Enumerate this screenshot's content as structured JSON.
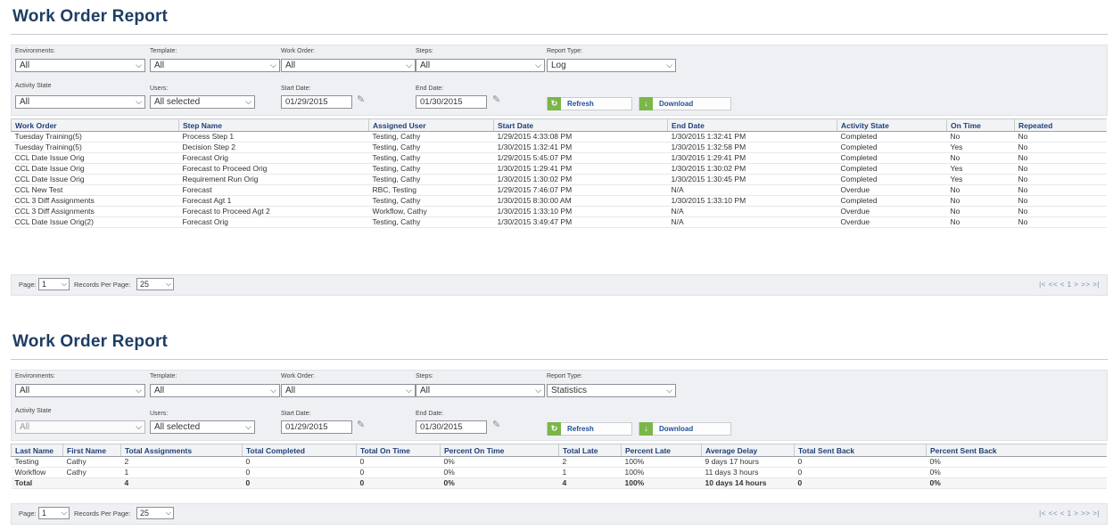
{
  "report1": {
    "title": "Work Order Report",
    "filters": {
      "environments": {
        "label": "Environments:",
        "value": "All"
      },
      "template": {
        "label": "Template:",
        "value": "All"
      },
      "work_order": {
        "label": "Work Order:",
        "value": "All"
      },
      "steps": {
        "label": "Steps:",
        "value": "All"
      },
      "report_type": {
        "label": "Report Type:",
        "value": "Log"
      },
      "activity_state": {
        "label": "Activity State",
        "value": "All"
      },
      "users": {
        "label": "Users:",
        "value": "All selected"
      },
      "start_date": {
        "label": "Start Date:",
        "value": "01/29/2015"
      },
      "end_date": {
        "label": "End Date:",
        "value": "01/30/2015"
      },
      "refresh_label": "Refresh",
      "download_label": "Download"
    },
    "table": {
      "headers": [
        "Work Order",
        "Step Name",
        "Assigned User",
        "Start Date",
        "End Date",
        "Activity State",
        "On Time",
        "Repeated"
      ],
      "rows": [
        [
          "Tuesday Training(5)",
          "Process Step 1",
          "Testing, Cathy",
          "1/29/2015 4:33:08 PM",
          "1/30/2015 1:32:41 PM",
          "Completed",
          "No",
          "No"
        ],
        [
          "Tuesday Training(5)",
          "Decision Step 2",
          "Testing, Cathy",
          "1/30/2015 1:32:41 PM",
          "1/30/2015 1:32:58 PM",
          "Completed",
          "Yes",
          "No"
        ],
        [
          "CCL Date Issue Orig",
          "Forecast Orig",
          "Testing, Cathy",
          "1/29/2015 5:45:07 PM",
          "1/30/2015 1:29:41 PM",
          "Completed",
          "No",
          "No"
        ],
        [
          "CCL Date Issue Orig",
          "Forecast to Proceed Orig",
          "Testing, Cathy",
          "1/30/2015 1:29:41 PM",
          "1/30/2015 1:30:02 PM",
          "Completed",
          "Yes",
          "No"
        ],
        [
          "CCL Date Issue Orig",
          "Requirement Run Orig",
          "Testing, Cathy",
          "1/30/2015 1:30:02 PM",
          "1/30/2015 1:30:45 PM",
          "Completed",
          "Yes",
          "No"
        ],
        [
          "CCL New Test",
          "Forecast",
          "RBC, Testing",
          "1/29/2015 7:46:07 PM",
          "N/A",
          "Overdue",
          "No",
          "No"
        ],
        [
          "CCL 3 Diff Assignments",
          "Forecast Agt 1",
          "Testing, Cathy",
          "1/30/2015 8:30:00 AM",
          "1/30/2015 1:33:10 PM",
          "Completed",
          "No",
          "No"
        ],
        [
          "CCL 3 Diff Assignments",
          "Forecast to Proceed Agt 2",
          "Workflow, Cathy",
          "1/30/2015 1:33:10 PM",
          "N/A",
          "Overdue",
          "No",
          "No"
        ],
        [
          "CCL Date Issue Orig(2)",
          "Forecast Orig",
          "Testing, Cathy",
          "1/30/2015 3:49:47 PM",
          "N/A",
          "Overdue",
          "No",
          "No"
        ]
      ]
    },
    "pager": {
      "page_label": "Page:",
      "page_value": "1",
      "rpp_label": "Records Per Page:",
      "rpp_value": "25",
      "nav": "|< << < 1 > >> >|"
    }
  },
  "report2": {
    "title": "Work Order Report",
    "filters": {
      "environments": {
        "label": "Environments:",
        "value": "All"
      },
      "template": {
        "label": "Template:",
        "value": "All"
      },
      "work_order": {
        "label": "Work Order:",
        "value": "All"
      },
      "steps": {
        "label": "Steps:",
        "value": "All"
      },
      "report_type": {
        "label": "Report Type:",
        "value": "Statistics"
      },
      "activity_state": {
        "label": "Activity State",
        "value": "All"
      },
      "users": {
        "label": "Users:",
        "value": "All selected"
      },
      "start_date": {
        "label": "Start Date:",
        "value": "01/29/2015"
      },
      "end_date": {
        "label": "End Date:",
        "value": "01/30/2015"
      },
      "refresh_label": "Refresh",
      "download_label": "Download"
    },
    "table": {
      "headers": [
        "Last Name",
        "First Name",
        "Total Assignments",
        "Total Completed",
        "Total On Time",
        "Percent On Time",
        "Total Late",
        "Percent Late",
        "Average Delay",
        "Total Sent Back",
        "Percent Sent Back"
      ],
      "rows": [
        [
          "Testing",
          "Cathy",
          "2",
          "0",
          "0",
          "0%",
          "2",
          "100%",
          "9 days 17 hours",
          "0",
          "0%"
        ],
        [
          "Workflow",
          "Cathy",
          "1",
          "0",
          "0",
          "0%",
          "1",
          "100%",
          "11 days 3 hours",
          "0",
          "0%"
        ]
      ],
      "total": [
        "Total",
        "",
        "4",
        "0",
        "0",
        "0%",
        "4",
        "100%",
        "10 days 14 hours",
        "0",
        "0%"
      ]
    },
    "pager": {
      "page_label": "Page:",
      "page_value": "1",
      "rpp_label": "Records Per Page:",
      "rpp_value": "25",
      "nav": "|< << < 1 > >> >|"
    }
  }
}
